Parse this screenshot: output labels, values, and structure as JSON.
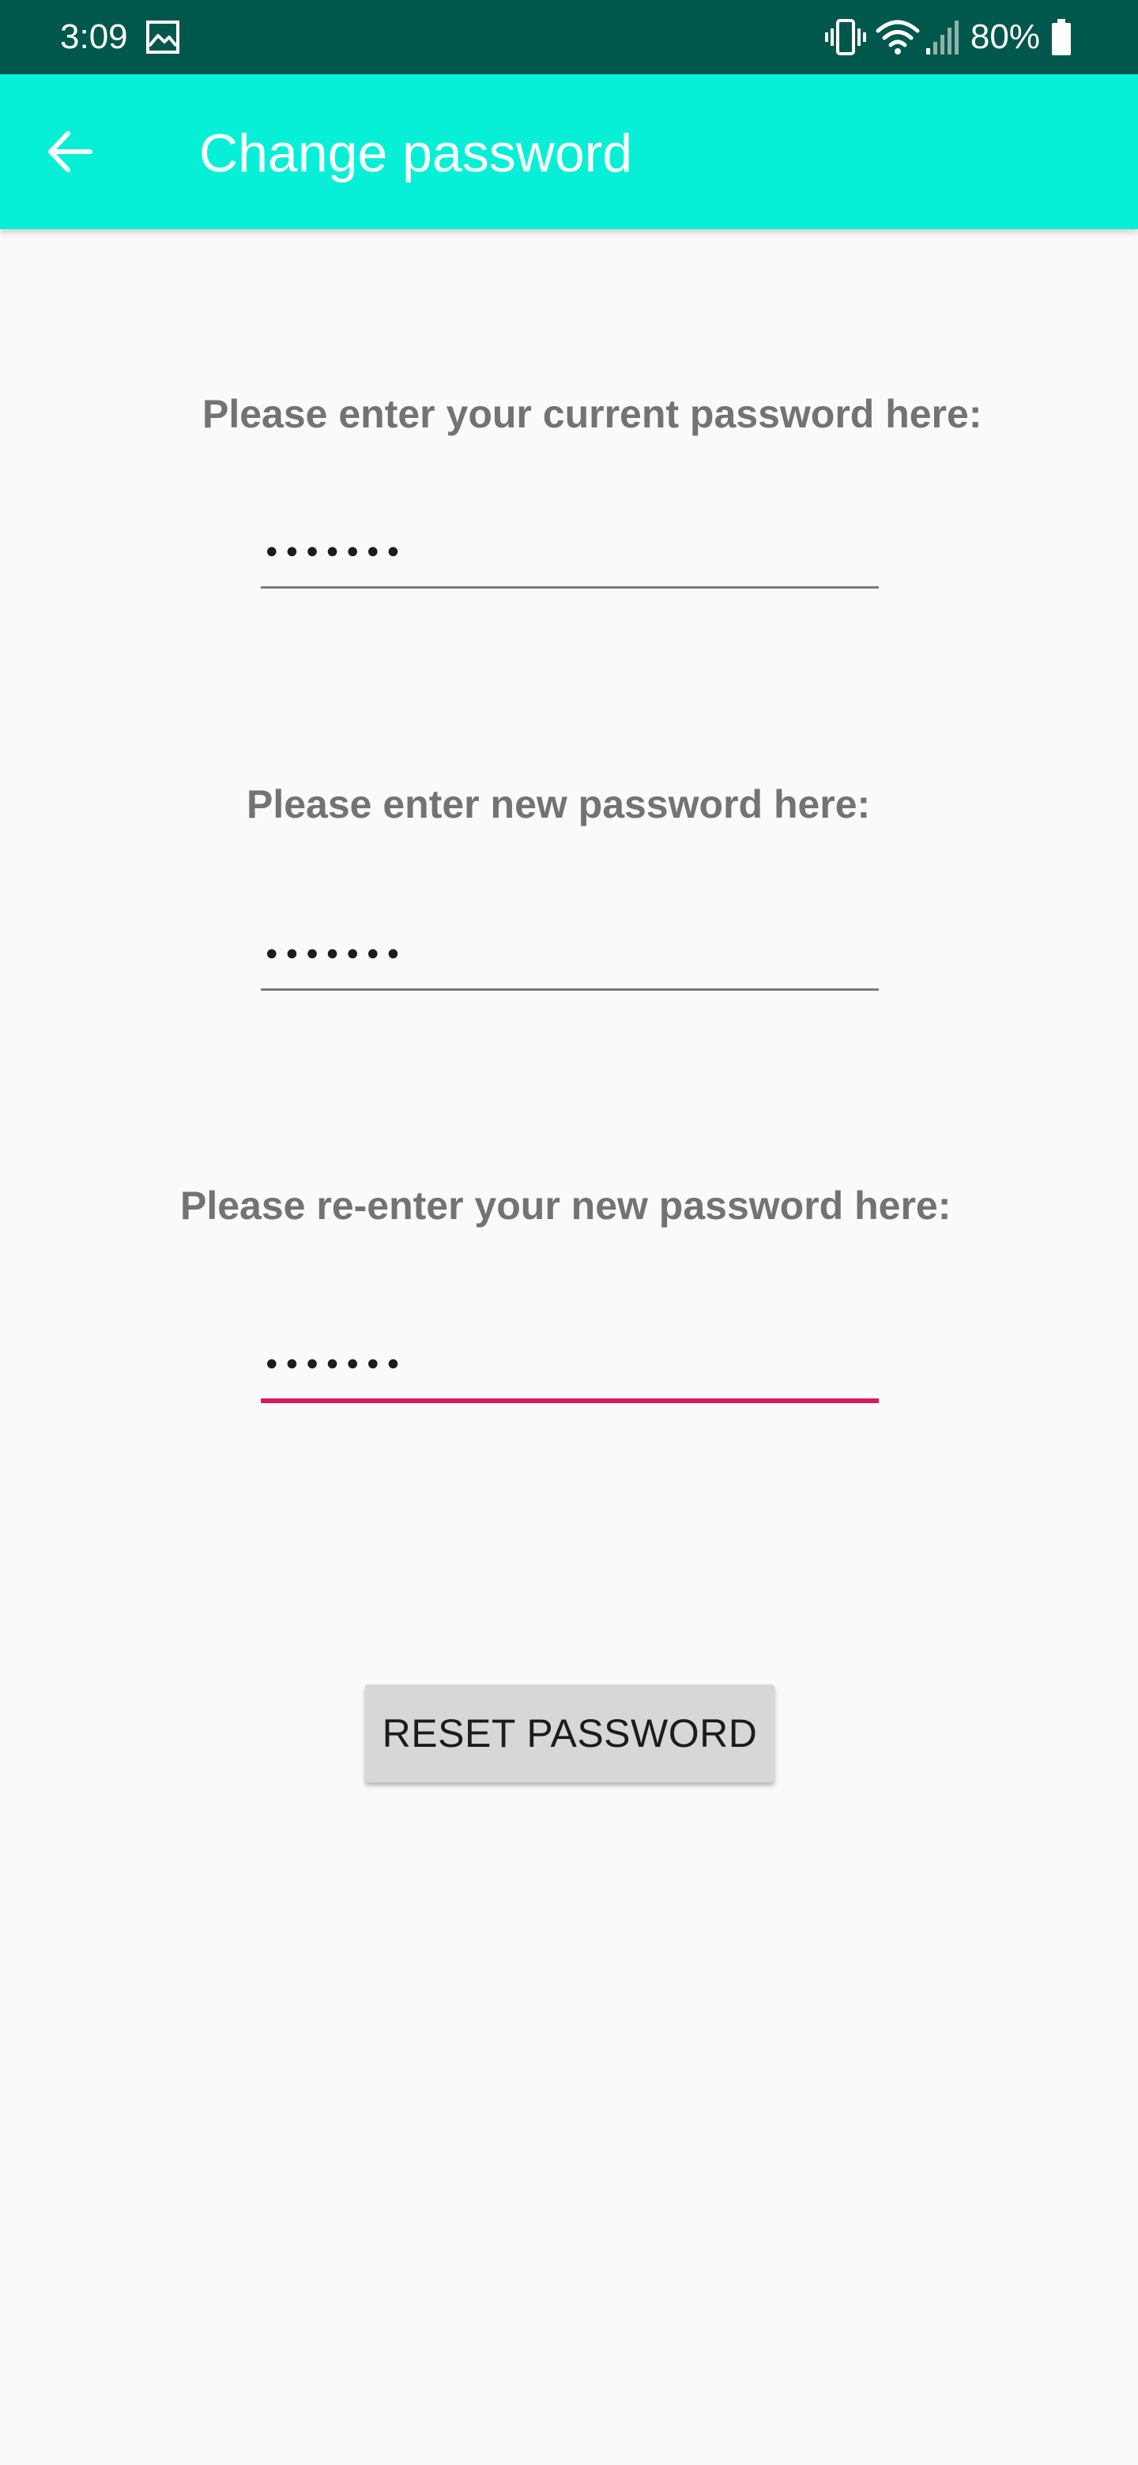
{
  "status_bar": {
    "time": "3:09",
    "battery_percent": "80%",
    "icons": [
      "gallery-icon",
      "vibrate-icon",
      "wifi-icon",
      "signal-icon",
      "battery-icon"
    ]
  },
  "app_bar": {
    "title": "Change password",
    "back_icon": "arrow-back-icon",
    "background_color": "#07f0d7"
  },
  "form": {
    "current_password": {
      "label": "Please enter your current password here:",
      "value_masked": "•••••••"
    },
    "new_password": {
      "label": "Please enter new password here:",
      "value_masked": "•••••••"
    },
    "confirm_password": {
      "label": "Please re-enter your new password here:",
      "value_masked": "•••••••",
      "focused": true
    },
    "reset_button_label": "RESET PASSWORD"
  },
  "colors": {
    "status_bar": "#00574b",
    "accent": "#d81b60",
    "label_text": "#737373",
    "button_bg": "#d6d7d7"
  }
}
